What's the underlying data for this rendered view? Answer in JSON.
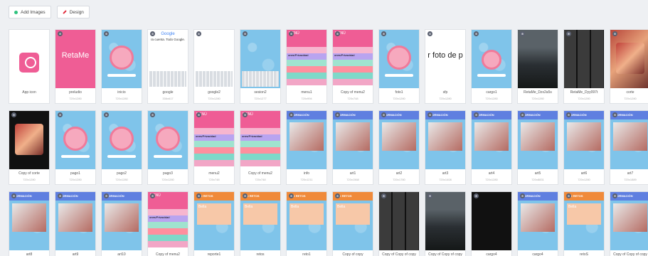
{
  "toolbar": {
    "add_images": "Add Images",
    "design": "Design"
  },
  "rows": [
    [
      {
        "name": "App icon",
        "dim": "",
        "t": "appicon"
      },
      {
        "name": "preludio",
        "dim": "720x1280",
        "t": "pink"
      },
      {
        "name": "inicio",
        "dim": "720x1280",
        "t": "blue-ring"
      },
      {
        "name": "google",
        "dim": "336x617",
        "t": "google"
      },
      {
        "name": "google2",
        "dim": "720x1280",
        "t": "white-kbd"
      },
      {
        "name": "sesion2",
        "dim": "720x1277",
        "t": "blue-kbd"
      },
      {
        "name": "menu1",
        "dim": "720x994",
        "t": "menu"
      },
      {
        "name": "Copy of menu2",
        "dim": "720x748",
        "t": "menu"
      },
      {
        "name": "foto1",
        "dim": "720x1280",
        "t": "blue-ring"
      },
      {
        "name": "sfp",
        "dim": "720x1280",
        "t": "text"
      },
      {
        "name": "cargo1",
        "dim": "720x1280",
        "t": "blue-ring2"
      },
      {
        "name": "RetaMe_Dzx2a5s",
        "dim": "720x1280",
        "t": "dark"
      },
      {
        "name": "RetaMe_Dyy097t",
        "dim": "720x1280",
        "t": "gallery"
      },
      {
        "name": "corte",
        "dim": "720x1280",
        "t": "photo"
      }
    ],
    [
      {
        "name": "Copy of corte",
        "dim": "720x1280",
        "t": "photo-black"
      },
      {
        "name": "pago1",
        "dim": "720x1280",
        "t": "blue-ring"
      },
      {
        "name": "pago2",
        "dim": "720x1280",
        "t": "blue-ring"
      },
      {
        "name": "pago3",
        "dim": "720x1280",
        "t": "blue-ring"
      },
      {
        "name": "menu2",
        "dim": "720x748",
        "t": "menu"
      },
      {
        "name": "Copy of menu2",
        "dim": "720x748",
        "t": "menu"
      },
      {
        "name": "info",
        "dim": "720x1211",
        "t": "info"
      },
      {
        "name": "art1",
        "dim": "720x1568",
        "t": "info"
      },
      {
        "name": "art2",
        "dim": "720x1780",
        "t": "info"
      },
      {
        "name": "art3",
        "dim": "720x1408",
        "t": "info"
      },
      {
        "name": "art4",
        "dim": "720x1280",
        "t": "info"
      },
      {
        "name": "art5",
        "dim": "720x8831",
        "t": "info"
      },
      {
        "name": "art6",
        "dim": "720x1280",
        "t": "info"
      },
      {
        "name": "art7",
        "dim": "720x1889",
        "t": "info"
      }
    ],
    [
      {
        "name": "art8",
        "dim": "720x1280",
        "t": "info"
      },
      {
        "name": "art9",
        "dim": "720x1280",
        "t": "info"
      },
      {
        "name": "art10",
        "dim": "720x1280",
        "t": "info"
      },
      {
        "name": "Copy of menu2",
        "dim": "720x748",
        "t": "menu"
      },
      {
        "name": "reporte1",
        "dim": "720x1280",
        "t": "orange"
      },
      {
        "name": "retos",
        "dim": "720x1280",
        "t": "orange"
      },
      {
        "name": "reto1",
        "dim": "720x1280",
        "t": "orange"
      },
      {
        "name": "Copy of copy",
        "dim": "720x1280",
        "t": "orange"
      },
      {
        "name": "Copy of Copy of copy",
        "dim": "720x1280",
        "t": "gallery"
      },
      {
        "name": "Copy of Copy of copy",
        "dim": "720x1280",
        "t": "dark"
      },
      {
        "name": "cargo4",
        "dim": "720x1280",
        "t": "black"
      },
      {
        "name": "cargo4",
        "dim": "720x1280",
        "t": "info"
      },
      {
        "name": "retoS",
        "dim": "720x1280",
        "t": "orange"
      },
      {
        "name": "Copy of Copy of copy",
        "dim": "720x1280",
        "t": "info"
      }
    ]
  ],
  "thumb_text": {
    "brand": "RetaMe",
    "google": "Google",
    "google_sub": "ra cuenta. Todo Google.",
    "menu_title": "MENÚ",
    "menu_item": "ones/Privacidad",
    "sfp": "r foto de p",
    "info_header": "INFORMACIÓN",
    "retos_header": "PRO RETOS",
    "reto_title": "Bella",
    "reporte_text": "¡Te atreves!"
  },
  "colors": {
    "pink": "#ef5d95",
    "blue": "#7fc4ea",
    "header_blue": "#5f7fe0",
    "header_orange": "#f08a3a"
  }
}
